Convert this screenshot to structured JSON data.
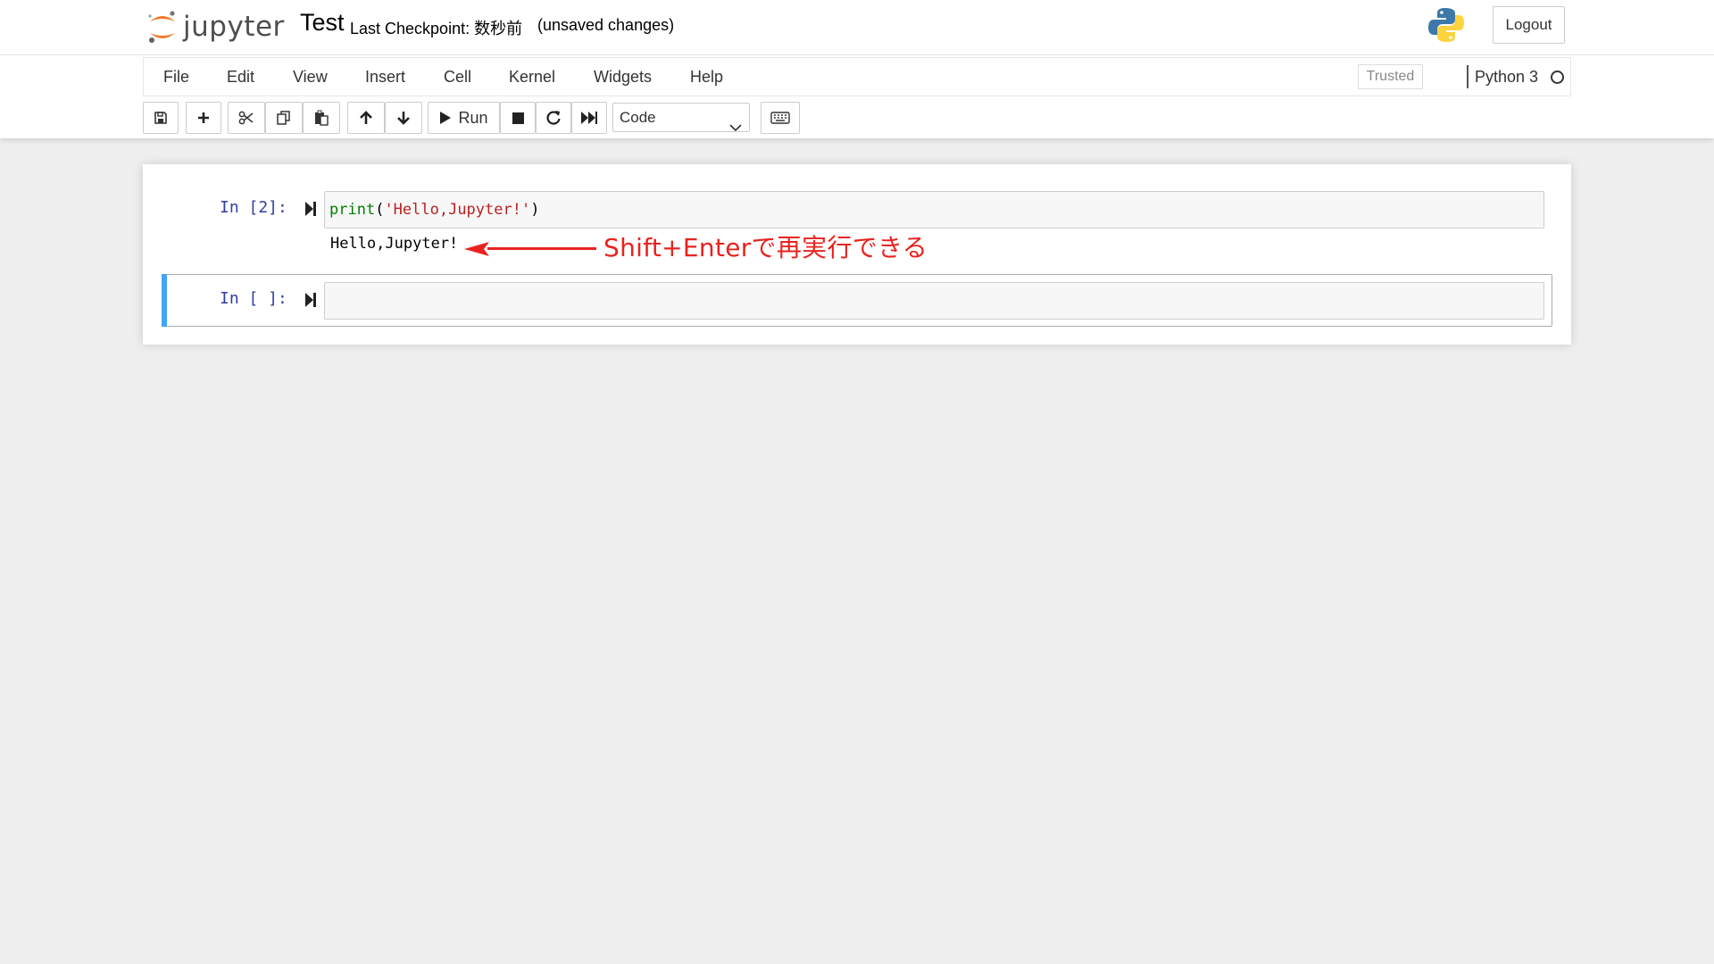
{
  "header": {
    "logo_text": "jupyter",
    "notebook_name": "Test",
    "checkpoint": "Last Checkpoint: 数秒前",
    "unsaved": "(unsaved changes)",
    "logout_label": "Logout"
  },
  "menubar": {
    "items": [
      "File",
      "Edit",
      "View",
      "Insert",
      "Cell",
      "Kernel",
      "Widgets",
      "Help"
    ],
    "trusted_label": "Trusted",
    "kernel_name": "Python 3"
  },
  "toolbar": {
    "run_label": "Run",
    "cell_type": "Code",
    "icons": [
      "save-icon",
      "plus-icon",
      "cut-icon",
      "copy-icon",
      "paste-icon",
      "arrow-up-icon",
      "arrow-down-icon",
      "play-icon",
      "stop-icon",
      "restart-icon",
      "fast-forward-icon",
      "keyboard-icon"
    ]
  },
  "cells": [
    {
      "prompt": "In [2]:",
      "code_fn": "print",
      "code_open": "(",
      "code_str": "'Hello,Jupyter!'",
      "code_close": ")",
      "output": "Hello,Jupyter!"
    },
    {
      "prompt": "In [ ]:",
      "code": ""
    }
  ],
  "annotation": {
    "text": "Shift+Enterで再実行できる",
    "color": "#e8231f"
  },
  "colors": {
    "selected_cell_bar": "#42a5f5",
    "prompt": "#303f9f",
    "jupyter_orange": "#f37726"
  }
}
